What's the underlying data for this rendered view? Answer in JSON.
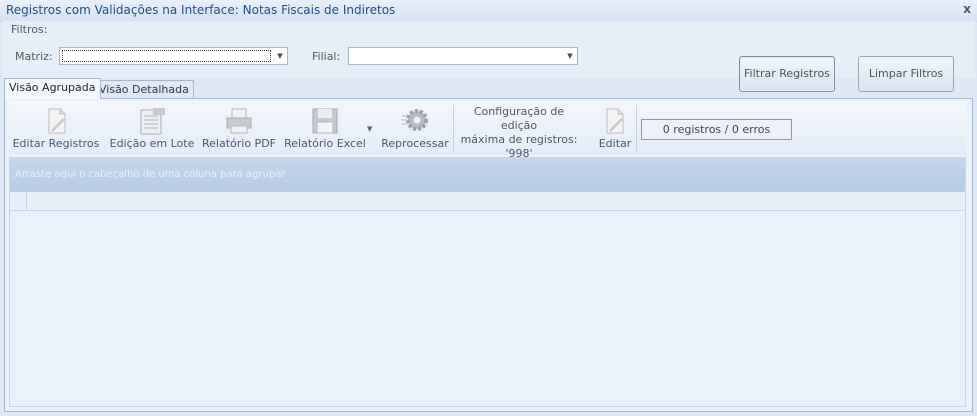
{
  "window": {
    "title": "Registros com Validações na Interface: Notas Fiscais de Indiretos",
    "close_glyph": "x"
  },
  "filters": {
    "section_label": "Filtros:",
    "matriz_label": "Matriz:",
    "matriz_value": "",
    "filial_label": "Filial:",
    "filial_value": "",
    "filter_button": "Filtrar Registros",
    "clear_button": "Limpar Filtros"
  },
  "tabs": [
    {
      "label": "Visão Agrupada",
      "active": true
    },
    {
      "label": "Visão Detalhada",
      "active": false
    }
  ],
  "toolbar": {
    "edit_records": "Editar Registros",
    "batch_edit": "Edição em Lote",
    "pdf_report": "Relatório PDF",
    "excel_report": "Relatório Excel",
    "reprocess": "Reprocessar",
    "config_line1": "Configuração de edição",
    "config_line2": "máxima de registros:",
    "config_value": "'998'",
    "edit": "Editar",
    "status": "0 registros / 0 erros"
  },
  "grid": {
    "group_hint": "Arraste aqui o cabeçalho de uma coluna para agrupar"
  },
  "icons": [
    "close-icon",
    "combo-arrow-icon",
    "document-edit-icon",
    "batch-edit-icon",
    "printer-pdf-icon",
    "floppy-excel-icon",
    "gear-reprocess-icon",
    "page-edit-icon"
  ],
  "colors": {
    "title": "#1e4e8c",
    "group_panel": "#b5cae5",
    "background": "#dfe9f5"
  }
}
